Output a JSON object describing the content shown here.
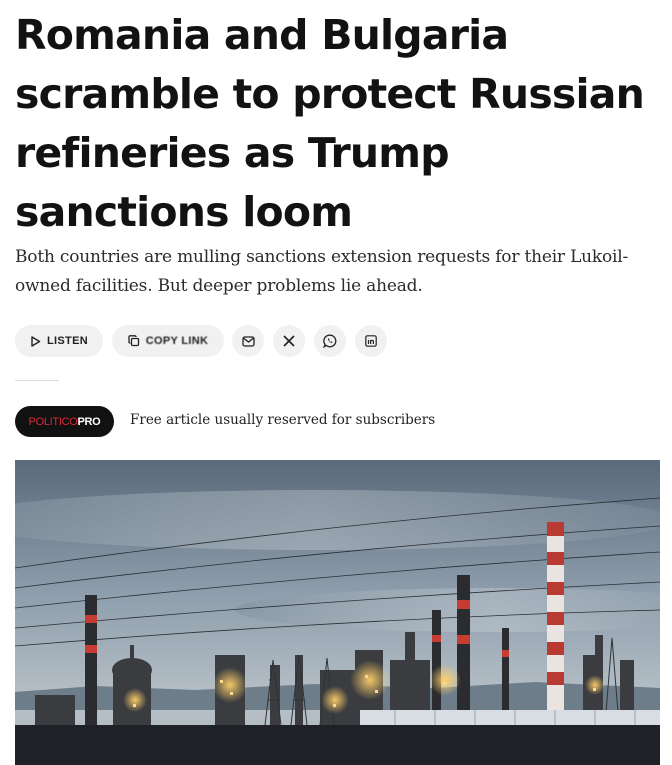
{
  "article": {
    "headline": "Romania and Bulgaria scramble to protect Russian refineries as Trump sanctions loom",
    "dek": "Both countries are mulling sanctions extension requests for their Lukoil-owned facilities. But deeper problems lie ahead."
  },
  "share": {
    "listen_label": "LISTEN",
    "copy_link_label": "COPY LINK",
    "icons": [
      "play-icon",
      "copy-icon",
      "mail-icon",
      "x-icon",
      "whatsapp-icon",
      "linkedin-icon"
    ]
  },
  "badge": {
    "brand_part1": "POLITICO",
    "brand_part2": "PRO",
    "brand_colors": {
      "politico": "#e0263b",
      "pro": "#ffffff",
      "background": "#111111"
    }
  },
  "notice": {
    "text": "Free article usually reserved for subscribers"
  },
  "hero_image": {
    "subject": "industrial-refinery-at-dusk"
  }
}
